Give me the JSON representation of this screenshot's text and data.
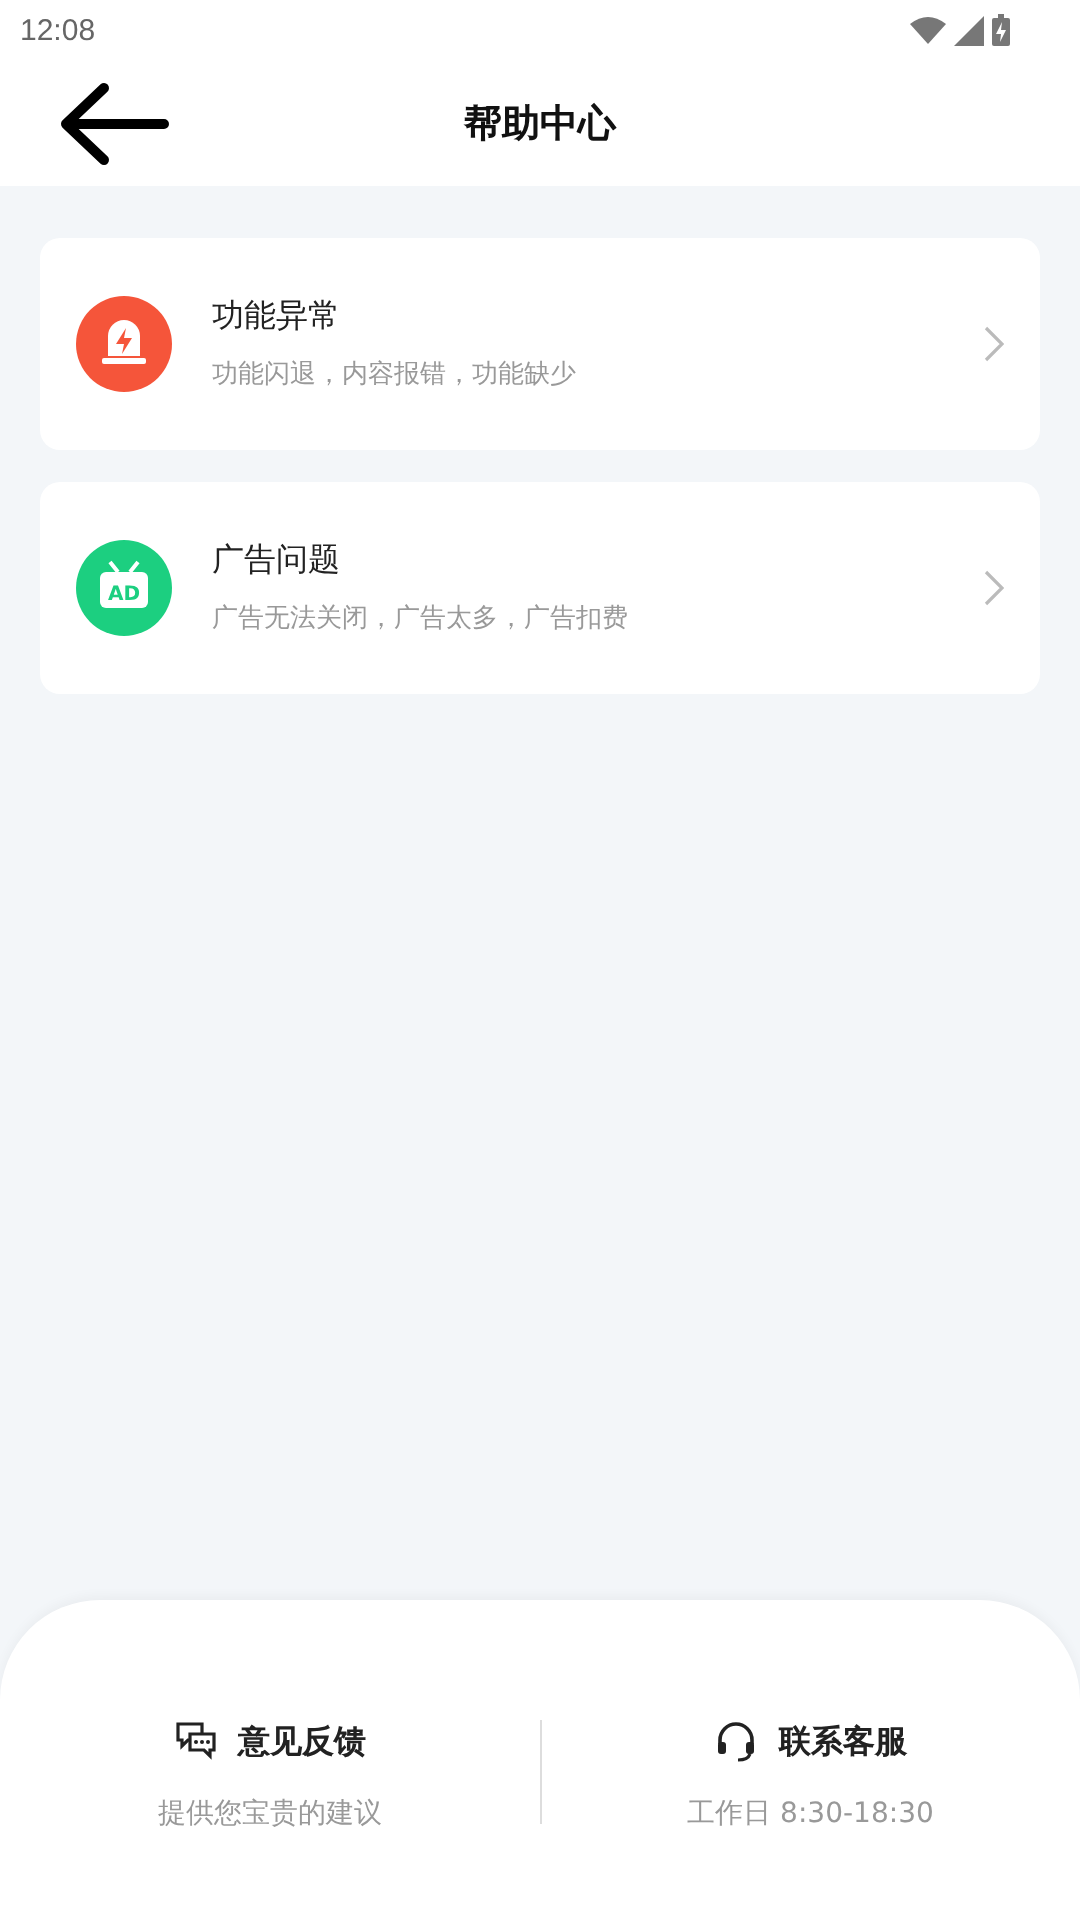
{
  "status_bar": {
    "time": "12:08"
  },
  "header": {
    "title": "帮助中心"
  },
  "categories": [
    {
      "kind": "alert",
      "title": "功能异常",
      "subtitle": "功能闪退，内容报错，功能缺少",
      "color": "#f5553a"
    },
    {
      "kind": "ad",
      "icon_label": "AD",
      "title": "广告问题",
      "subtitle": "广告无法关闭，广告太多，广告扣费",
      "color": "#1ccf80"
    }
  ],
  "footer": [
    {
      "kind": "feedback",
      "title": "意见反馈",
      "subtitle": "提供您宝贵的建议"
    },
    {
      "kind": "service",
      "title": "联系客服",
      "subtitle": "工作日 8:30-18:30"
    }
  ]
}
